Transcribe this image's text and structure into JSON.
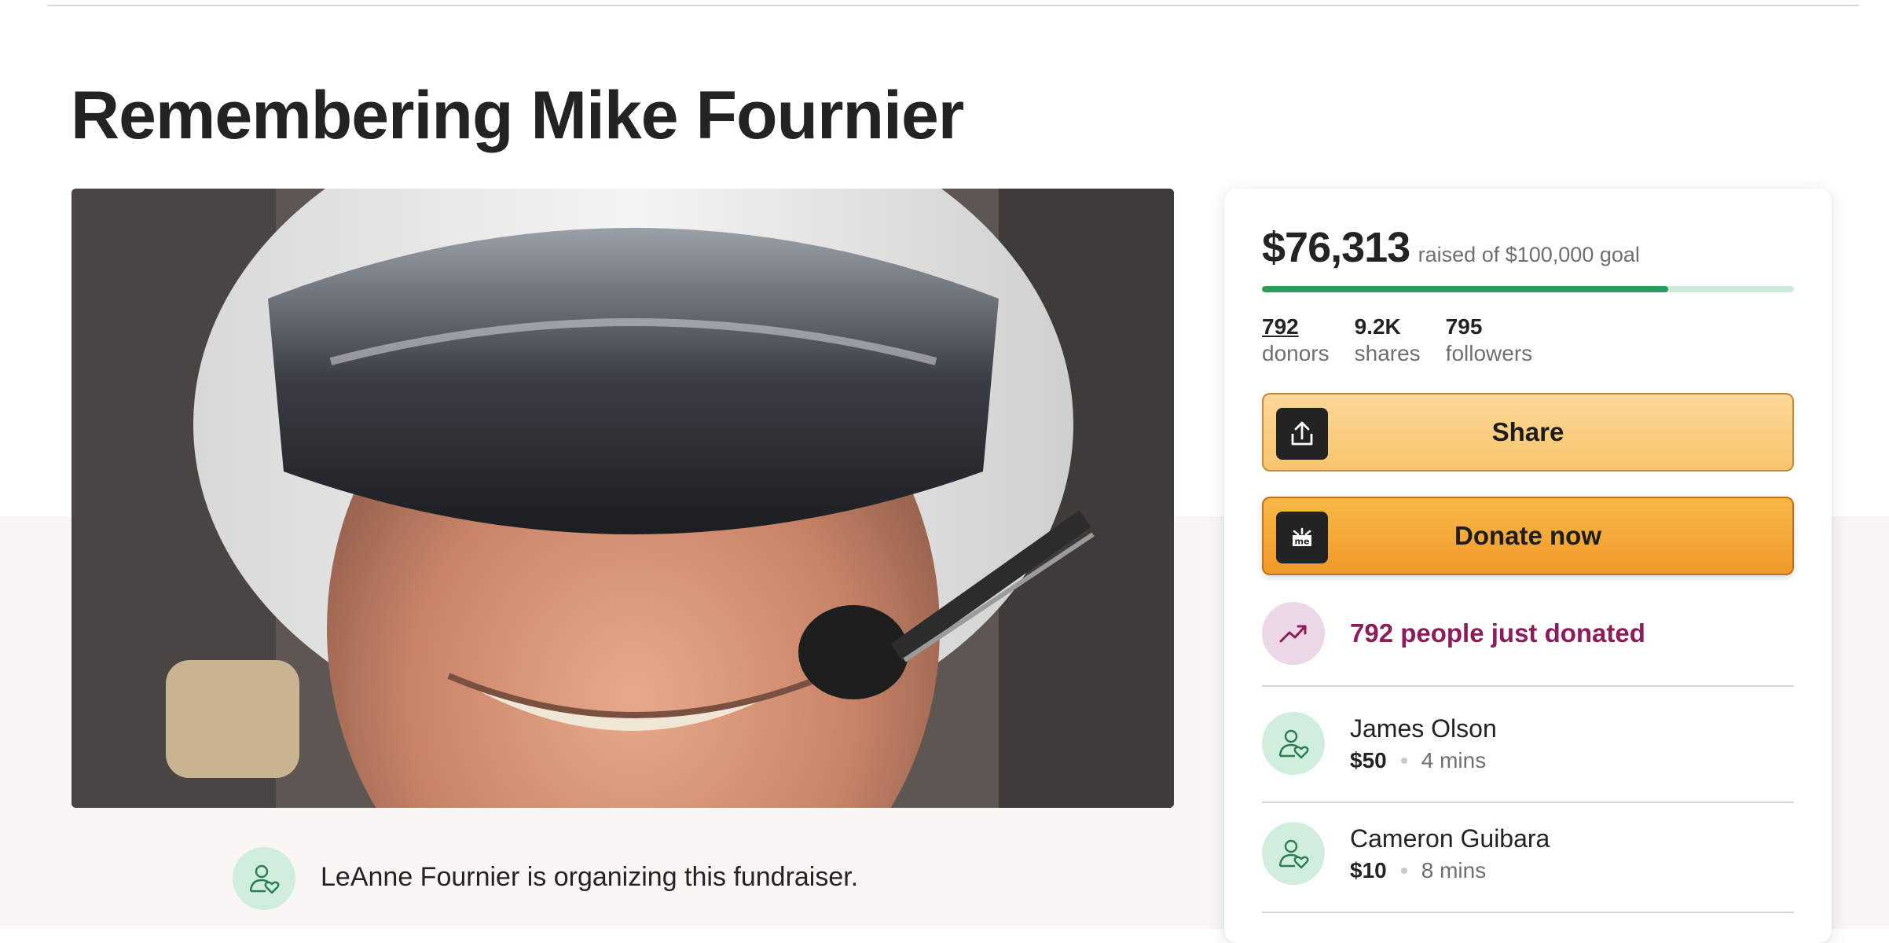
{
  "page": {
    "title": "Remembering Mike Fournier"
  },
  "organizer": {
    "text": "LeAnne Fournier is organizing this fundraiser."
  },
  "fundraiser": {
    "raised": "$76,313",
    "goal_text": "raised of $100,000 goal",
    "progress_fraction": 0.763
  },
  "stats": [
    {
      "value": "792",
      "label": "donors"
    },
    {
      "value": "9.2K",
      "label": "shares"
    },
    {
      "value": "795",
      "label": "followers"
    }
  ],
  "buttons": {
    "share_label": "Share",
    "donate_label": "Donate now"
  },
  "trend": {
    "text": "792 people just donated"
  },
  "donations": [
    {
      "name": "James Olson",
      "amount": "$50",
      "time": "4 mins"
    },
    {
      "name": "Cameron Guibara",
      "amount": "$10",
      "time": "8 mins"
    }
  ],
  "colors": {
    "progress": "#2b9a5a",
    "share_button": "#fcd68e",
    "donate_button": "#f5a836",
    "trend_text": "#8c1c5a",
    "avatar_bg": "#cfeedd"
  },
  "icons": {
    "share_button": "share-upload-icon",
    "donate_button": "gofundme-logo-icon",
    "trend": "trending-up-icon",
    "avatar": "person-heart-icon"
  }
}
